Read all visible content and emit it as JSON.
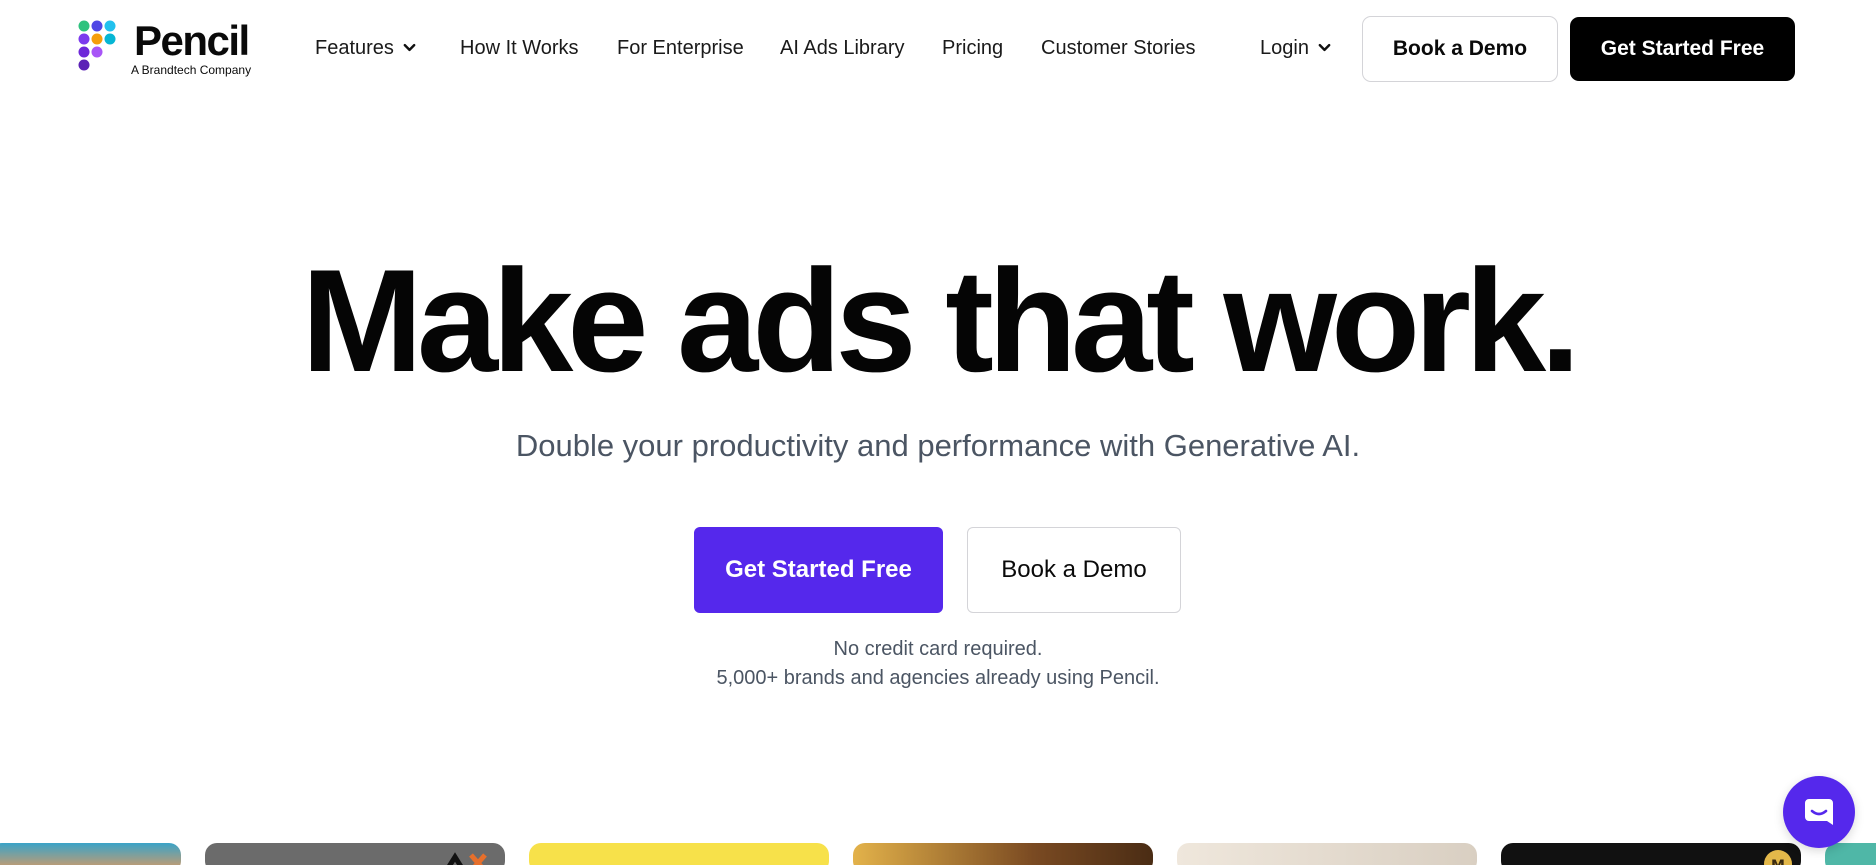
{
  "brand": {
    "name": "Pencil",
    "tagline": "A Brandtech Company",
    "dot_colors": [
      "#2ec27e",
      "#4f46e5",
      "#22c1ee",
      "#7c3aed",
      "#f59e0b",
      "#06b6d4",
      "#6d28d9",
      "#5b21b6"
    ]
  },
  "nav": {
    "features": "Features",
    "how_it_works": "How It Works",
    "for_enterprise": "For Enterprise",
    "ai_ads_library": "AI Ads Library",
    "pricing": "Pricing",
    "customer_stories": "Customer Stories",
    "login": "Login",
    "book_demo": "Book a Demo",
    "get_started": "Get Started Free"
  },
  "hero": {
    "title": "Make ads that work.",
    "subtitle": "Double your productivity and performance with Generative AI.",
    "cta_primary": "Get Started Free",
    "cta_secondary": "Book a Demo",
    "note_1": "No credit card required.",
    "note_2": "5,000+ brands and agencies already using Pencil."
  },
  "colors": {
    "accent": "#5528ec",
    "dark": "#000000",
    "text_muted": "#4b5563"
  },
  "thumbnails": [
    {
      "name": "sunset-ad",
      "color": "#2b8ab0"
    },
    {
      "name": "gray-ad",
      "color": "#6b6b6b"
    },
    {
      "name": "yellow-ad",
      "color": "#f7e14a"
    },
    {
      "name": "brown-ad",
      "color": "#8a5a2b"
    },
    {
      "name": "food-ad",
      "color": "#e8e1d6"
    },
    {
      "name": "black-ad",
      "color": "#111111"
    },
    {
      "name": "teal-ad",
      "color": "#4fb7a7"
    }
  ],
  "icons": {
    "chevron": "chevron-down-icon",
    "chat": "chat-icon"
  }
}
